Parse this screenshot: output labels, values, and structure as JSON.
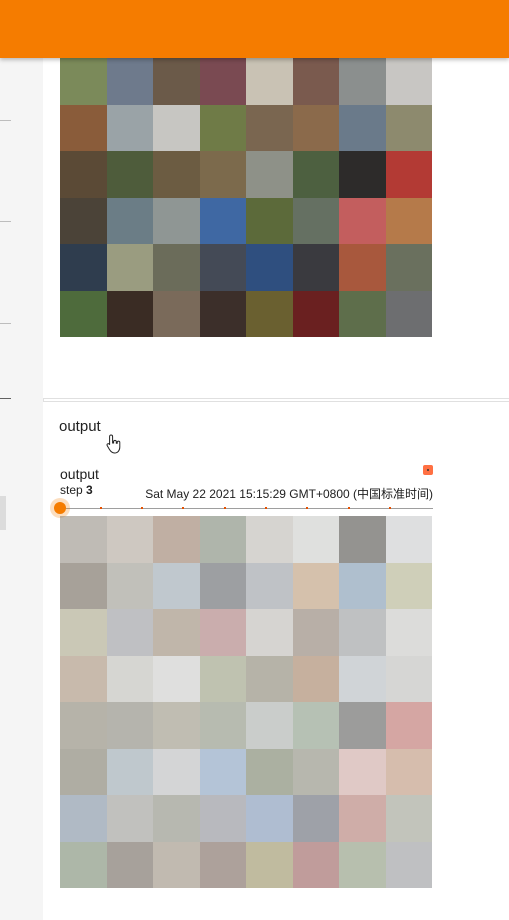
{
  "header": {
    "color": "#f57c00"
  },
  "top_grid": {
    "rows": 6,
    "cols": 8,
    "colors": [
      "#7b8a5a",
      "#6e7a8c",
      "#6b5a49",
      "#7a4a52",
      "#c9c2b4",
      "#7a5a4e",
      "#8b8f8e",
      "#c8c6c3",
      "#8a5c3a",
      "#9aa3a7",
      "#c7c6c2",
      "#6f7b47",
      "#7a6650",
      "#8b6a4b",
      "#6a7a8a",
      "#8d8a6e",
      "#5b4a36",
      "#4e5c3b",
      "#6c5c42",
      "#7c6a4c",
      "#8e9188",
      "#4d6040",
      "#2d2b2a",
      "#b33a34",
      "#4b4338",
      "#6b7d86",
      "#8f9694",
      "#3f68a3",
      "#5c6a3a",
      "#657062",
      "#c35e5e",
      "#b57a4a",
      "#2f3d4e",
      "#9a9c80",
      "#6b6c5a",
      "#444a56",
      "#2f4f7f",
      "#3a3a3f",
      "#a8583d",
      "#6a705e",
      "#4e6b3c",
      "#3a2c24",
      "#7a6a5a",
      "#3c2f2a",
      "#6a6030",
      "#6a2020",
      "#5e6e4b",
      "#6d6e70"
    ]
  },
  "section": {
    "title": "output"
  },
  "image_card": {
    "name": "output",
    "step_label": "step",
    "step_value": "3",
    "timestamp": "Sat May 22 2021 15:15:29 GMT+0800 (中国标准时间)",
    "slider_value": 0,
    "accent": "#f57c00"
  },
  "bottom_grid": {
    "rows": 8,
    "cols": 8,
    "colors": [
      "#8a8478",
      "#a59a8e",
      "#8c6e58",
      "#6d7866",
      "#b4b0a9",
      "#c5c6c3",
      "#3c3a35",
      "#c3c5c6",
      "#5e5345",
      "#8e8c82",
      "#8d9aa6",
      "#4c5056",
      "#8a9098",
      "#b38e68",
      "#6e8aa5",
      "#a8a780",
      "#9f9a7a",
      "#8b8d92",
      "#8d7a65",
      "#9e6a6a",
      "#b4b1ab",
      "#7d6e5e",
      "#8a8e90",
      "#c0c0bc",
      "#9a8268",
      "#b5b4ad",
      "#c5c5c2",
      "#8a9070",
      "#7a7460",
      "#97704f",
      "#a9b0b6",
      "#b4b4b0",
      "#7a7462",
      "#79776a",
      "#8c8672",
      "#7b8470",
      "#9fa4a0",
      "#7a8e76",
      "#4a4a48",
      "#b35c58",
      "#6e6a58",
      "#8a9aa4",
      "#b0b2b4",
      "#7794b6",
      "#667054",
      "#7c7c6c",
      "#c79c98",
      "#b4866a",
      "#6f8296",
      "#8e8e88",
      "#7c7e70",
      "#7d8088",
      "#6d86ab",
      "#4f5360",
      "#a86a60",
      "#8f9484",
      "#6a7c60",
      "#5e5448",
      "#8e8270",
      "#6a5448",
      "#8c8450",
      "#8c4a48",
      "#7c8a6c",
      "#8a8c90"
    ]
  }
}
